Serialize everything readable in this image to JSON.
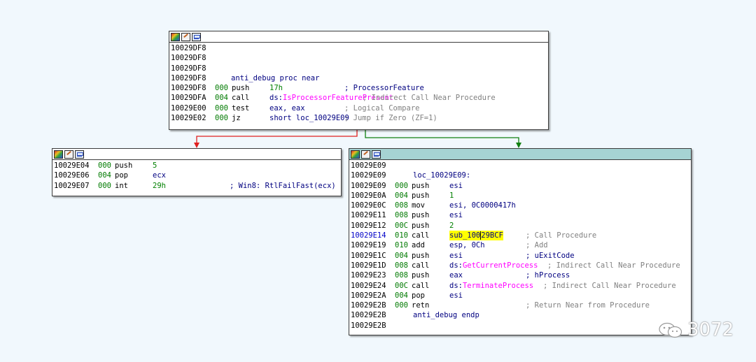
{
  "node_top": {
    "lines": [
      {
        "addr": "10029DF8",
        "sp": "",
        "mn": "",
        "op": "",
        "cmt": ""
      },
      {
        "addr": "10029DF8",
        "sp": "",
        "mn": "",
        "op": "",
        "cmt": ""
      },
      {
        "addr": "10029DF8",
        "sp": "",
        "mn": "",
        "op": "",
        "cmt": ""
      },
      {
        "addr": "10029DF8",
        "label": "anti_debug proc near"
      },
      {
        "addr": "10029DF8",
        "sp": "000",
        "mn": "push",
        "op": "17h",
        "cmt": "; ProcessorFeature"
      },
      {
        "addr": "10029DFA",
        "sp": "004",
        "mn": "call",
        "op_prefix": "ds:",
        "op_import": "IsProcessorFeaturePresent",
        "cmt": "; Indirect Call Near Procedure"
      },
      {
        "addr": "10029E00",
        "sp": "000",
        "mn": "test",
        "op": "eax, eax",
        "cmt": "; Logical Compare"
      },
      {
        "addr": "10029E02",
        "sp": "000",
        "mn": "jz",
        "op": "short loc_10029E09",
        "cmt": "; Jump if Zero (ZF=1)"
      }
    ]
  },
  "node_left": {
    "lines": [
      {
        "addr": "10029E04",
        "sp": "000",
        "mn": "push",
        "op": "5",
        "cmt": ""
      },
      {
        "addr": "10029E06",
        "sp": "004",
        "mn": "pop",
        "op": "ecx",
        "cmt": ""
      },
      {
        "addr": "10029E07",
        "sp": "000",
        "mn": "int",
        "op": "29h",
        "cmt": "; Win8: RtlFailFast(ecx)"
      }
    ]
  },
  "node_right": {
    "lines": [
      {
        "addr": "10029E09"
      },
      {
        "addr": "10029E09",
        "label": "loc_10029E09:"
      },
      {
        "addr": "10029E09",
        "sp": "000",
        "mn": "push",
        "op": "esi",
        "cmt": ""
      },
      {
        "addr": "10029E0A",
        "sp": "004",
        "mn": "push",
        "op": "1",
        "cmt": ""
      },
      {
        "addr": "10029E0C",
        "sp": "008",
        "mn": "mov",
        "op": "esi, 0C0000417h",
        "cmt": ""
      },
      {
        "addr": "10029E11",
        "sp": "008",
        "mn": "push",
        "op": "esi",
        "cmt": ""
      },
      {
        "addr": "10029E12",
        "sp": "00C",
        "mn": "push",
        "op": "2",
        "cmt": ""
      },
      {
        "addr": "10029E14",
        "sp": "010",
        "mn": "call",
        "op_hl_a": "sub_100",
        "op_hl_b": "29BCF",
        "cmt": "; Call Procedure",
        "addr_blue": true
      },
      {
        "addr": "10029E19",
        "sp": "010",
        "mn": "add",
        "op": "esp, 0Ch",
        "cmt": "; Add"
      },
      {
        "addr": "10029E1C",
        "sp": "004",
        "mn": "push",
        "op": "esi",
        "cmt": "; uExitCode"
      },
      {
        "addr": "10029E1D",
        "sp": "008",
        "mn": "call",
        "op_prefix": "ds:",
        "op_import": "GetCurrentProcess",
        "cmt": "; Indirect Call Near Procedure"
      },
      {
        "addr": "10029E23",
        "sp": "008",
        "mn": "push",
        "op": "eax",
        "cmt": "; hProcess"
      },
      {
        "addr": "10029E24",
        "sp": "00C",
        "mn": "call",
        "op_prefix": "ds:",
        "op_import": "TerminateProcess",
        "cmt": "; Indirect Call Near Procedure"
      },
      {
        "addr": "10029E2A",
        "sp": "004",
        "mn": "pop",
        "op": "esi",
        "cmt": ""
      },
      {
        "addr": "10029E2B",
        "sp": "000",
        "mn": "retn",
        "op": "",
        "cmt": "; Return Near from Procedure"
      },
      {
        "addr": "10029E2B",
        "label": "anti_debug endp"
      },
      {
        "addr": "10029E2B"
      }
    ]
  },
  "watermark": {
    "text": "3072"
  },
  "colors": {
    "background": "#f1f8fd",
    "edge_false": "#e02020",
    "edge_true": "#108010",
    "selected_header": "#a6d3d3",
    "highlight": "#ffff00"
  },
  "icons": [
    "color-palette-icon",
    "edit-icon",
    "graph-view-icon",
    "wechat-icon"
  ]
}
